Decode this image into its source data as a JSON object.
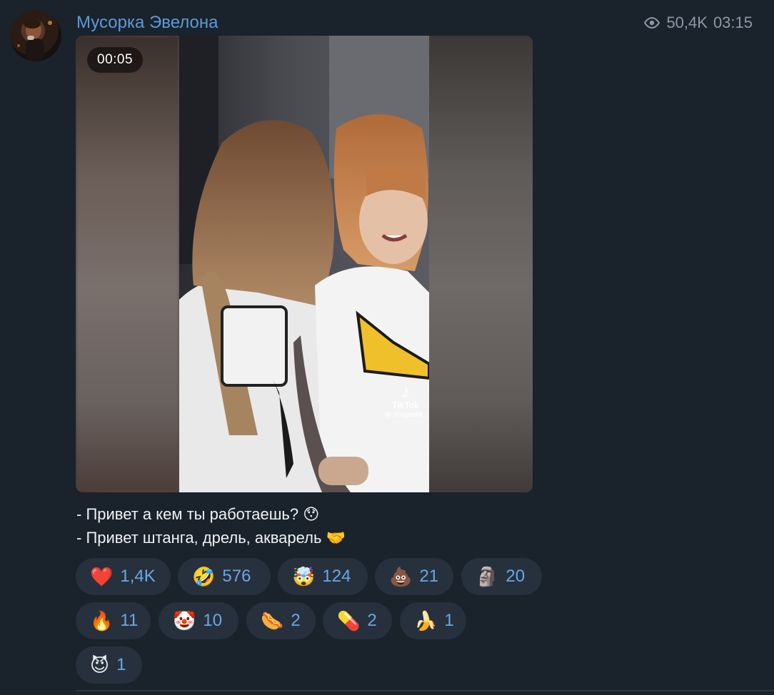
{
  "channel": {
    "name": "Мусорка Эвелона"
  },
  "meta": {
    "views": "50,4K",
    "time": "03:15",
    "views_icon": "eye-icon"
  },
  "video": {
    "timer": "00:05",
    "watermark": {
      "brand": "TikTok",
      "user": "@ reagentik_"
    }
  },
  "caption": {
    "line1": "- Привет а кем ты работаешь?",
    "line1_emoji": "😯",
    "line2": "- Привет штанга, дрель, акварель",
    "line2_emoji": "🤝"
  },
  "reactions": [
    {
      "emoji": "❤️",
      "count": "1,4K"
    },
    {
      "emoji": "🤣",
      "count": "576"
    },
    {
      "emoji": "🤯",
      "count": "124"
    },
    {
      "emoji": "💩",
      "count": "21"
    },
    {
      "emoji": "🗿",
      "count": "20"
    },
    {
      "emoji": "🔥",
      "count": "11"
    },
    {
      "emoji": "🤡",
      "count": "10"
    },
    {
      "emoji": "🌭",
      "count": "2"
    },
    {
      "emoji": "💊",
      "count": "2"
    },
    {
      "emoji": "🍌",
      "count": "1"
    },
    {
      "emoji": "😈",
      "count": "1"
    }
  ],
  "colors": {
    "background": "#1a222c",
    "accent": "#5b9bd8",
    "reaction_bg": "#26313d",
    "reaction_count": "#6aa7e4"
  }
}
